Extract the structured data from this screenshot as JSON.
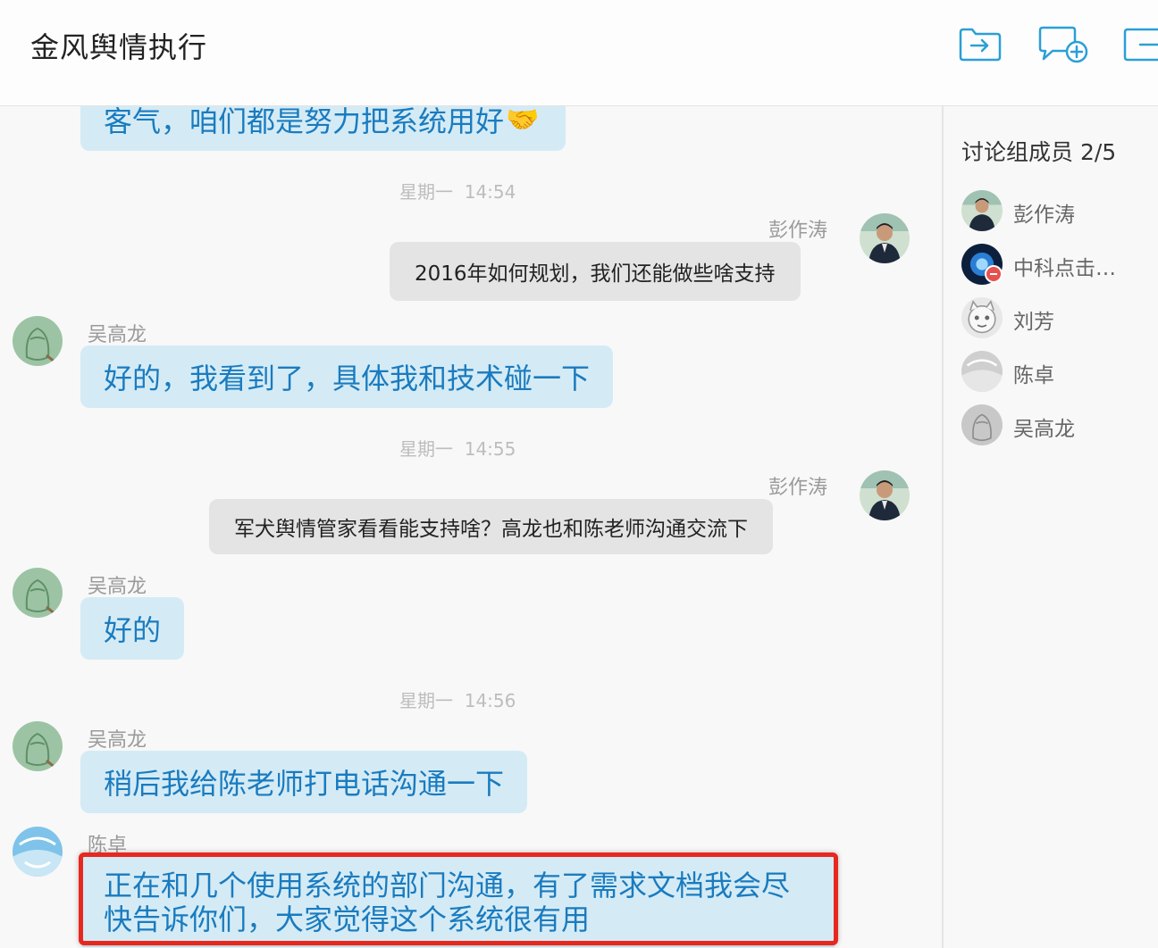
{
  "window": {
    "title": "金风舆情执行"
  },
  "header_actions": [
    {
      "icon": "folder-export-icon"
    },
    {
      "icon": "add-chat-icon"
    },
    {
      "icon": "exit-icon"
    }
  ],
  "messages": {
    "m0": {
      "text": "客气，咱们都是努力把系统用好"
    },
    "t1": {
      "day": "星期一",
      "time": "14:54"
    },
    "m1": {
      "sender": "彭作涛",
      "text": "2016年如何规划，我们还能做些啥支持"
    },
    "m2": {
      "sender": "吴高龙",
      "text": "好的，我看到了，具体我和技术碰一下"
    },
    "t2": {
      "day": "星期一",
      "time": "14:55"
    },
    "m3": {
      "sender": "彭作涛",
      "text": "军犬舆情管家看看能支持啥？高龙也和陈老师沟通交流下"
    },
    "m4": {
      "sender": "吴高龙",
      "text": "好的"
    },
    "t3": {
      "day": "星期一",
      "time": "14:56"
    },
    "m5": {
      "sender": "吴高龙",
      "text": "稍后我给陈老师打电话沟通一下"
    },
    "m6": {
      "sender": "陈卓",
      "line1": "正在和几个使用系统的部门沟通，有了需求文档我会尽",
      "line2": "快告诉你们，大家觉得这个系统很有用"
    }
  },
  "sidebar": {
    "title": "讨论组成员 2/5",
    "members": [
      {
        "name": "彭作涛"
      },
      {
        "name": "中科点击…"
      },
      {
        "name": "刘芳"
      },
      {
        "name": "陈卓"
      },
      {
        "name": "吴高龙"
      }
    ]
  },
  "colors": {
    "bubble_left": "#d4ebf5",
    "bubble_left_text": "#1a7bbf",
    "bubble_right": "#e4e4e4",
    "highlight_border": "#e8281f",
    "icon_accent": "#2a9fd6"
  }
}
